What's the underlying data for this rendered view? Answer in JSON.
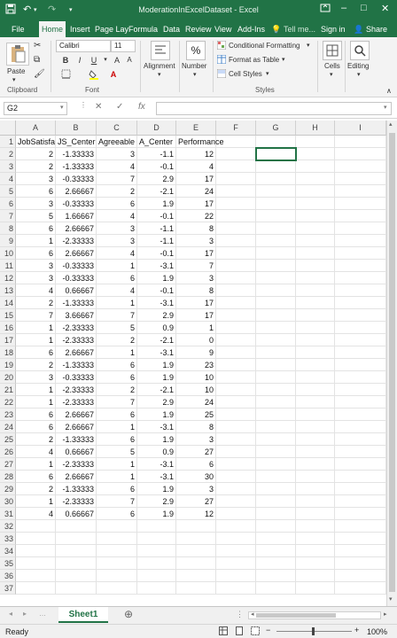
{
  "window": {
    "title": "ModerationInExcelDataset - Excel",
    "sign_in": "Sign in",
    "share": "Share"
  },
  "tabs": [
    "File",
    "Home",
    "Insert",
    "Page Lay",
    "Formula",
    "Data",
    "Review",
    "View",
    "Add-Ins",
    "Tell me..."
  ],
  "ribbon": {
    "paste_label": "Paste",
    "font_name": "Calibri",
    "font_size": "11",
    "bold": "B",
    "italic": "I",
    "underline": "U",
    "alignment_label": "Alignment",
    "number_label": "Number",
    "number_symbol": "%",
    "conditional_formatting": "Conditional Formatting",
    "format_as_table": "Format as Table",
    "cell_styles": "Cell Styles",
    "cells_label": "Cells",
    "editing_label": "Editing",
    "groups": {
      "clipboard": "Clipboard",
      "font": "Font",
      "styles": "Styles"
    }
  },
  "formula_bar": {
    "name_box": "G2",
    "cancel": "✕",
    "enter": "✓",
    "fx": "fx",
    "value": ""
  },
  "grid": {
    "columns": [
      "A",
      "B",
      "C",
      "D",
      "E",
      "F",
      "G",
      "H",
      "I"
    ],
    "headers": [
      "JobSatisfa",
      "JS_Center",
      "Agreeable",
      "A_Center",
      "Performance"
    ],
    "rows": [
      [
        "2",
        "-1.33333",
        "3",
        "-1.1",
        "12"
      ],
      [
        "2",
        "-1.33333",
        "4",
        "-0.1",
        "4"
      ],
      [
        "3",
        "-0.33333",
        "7",
        "2.9",
        "17"
      ],
      [
        "6",
        "2.66667",
        "2",
        "-2.1",
        "24"
      ],
      [
        "3",
        "-0.33333",
        "6",
        "1.9",
        "17"
      ],
      [
        "5",
        "1.66667",
        "4",
        "-0.1",
        "22"
      ],
      [
        "6",
        "2.66667",
        "3",
        "-1.1",
        "8"
      ],
      [
        "1",
        "-2.33333",
        "3",
        "-1.1",
        "3"
      ],
      [
        "6",
        "2.66667",
        "4",
        "-0.1",
        "17"
      ],
      [
        "3",
        "-0.33333",
        "1",
        "-3.1",
        "7"
      ],
      [
        "3",
        "-0.33333",
        "6",
        "1.9",
        "3"
      ],
      [
        "4",
        "0.66667",
        "4",
        "-0.1",
        "8"
      ],
      [
        "2",
        "-1.33333",
        "1",
        "-3.1",
        "17"
      ],
      [
        "7",
        "3.66667",
        "7",
        "2.9",
        "17"
      ],
      [
        "1",
        "-2.33333",
        "5",
        "0.9",
        "1"
      ],
      [
        "1",
        "-2.33333",
        "2",
        "-2.1",
        "0"
      ],
      [
        "6",
        "2.66667",
        "1",
        "-3.1",
        "9"
      ],
      [
        "2",
        "-1.33333",
        "6",
        "1.9",
        "23"
      ],
      [
        "3",
        "-0.33333",
        "6",
        "1.9",
        "10"
      ],
      [
        "1",
        "-2.33333",
        "2",
        "-2.1",
        "10"
      ],
      [
        "1",
        "-2.33333",
        "7",
        "2.9",
        "24"
      ],
      [
        "6",
        "2.66667",
        "6",
        "1.9",
        "25"
      ],
      [
        "6",
        "2.66667",
        "1",
        "-3.1",
        "8"
      ],
      [
        "2",
        "-1.33333",
        "6",
        "1.9",
        "3"
      ],
      [
        "4",
        "0.66667",
        "5",
        "0.9",
        "27"
      ],
      [
        "1",
        "-2.33333",
        "1",
        "-3.1",
        "6"
      ],
      [
        "6",
        "2.66667",
        "1",
        "-3.1",
        "30"
      ],
      [
        "2",
        "-1.33333",
        "6",
        "1.9",
        "3"
      ],
      [
        "1",
        "-2.33333",
        "7",
        "2.9",
        "27"
      ],
      [
        "4",
        "0.66667",
        "6",
        "1.9",
        "12"
      ]
    ],
    "row_count": 37,
    "selected_cell": "G2"
  },
  "sheets": [
    "Sheet1"
  ],
  "status": {
    "ready": "Ready",
    "zoom": "100%",
    "zoom_minus": "−",
    "zoom_plus": "+"
  },
  "colors": {
    "accent": "#217346"
  }
}
